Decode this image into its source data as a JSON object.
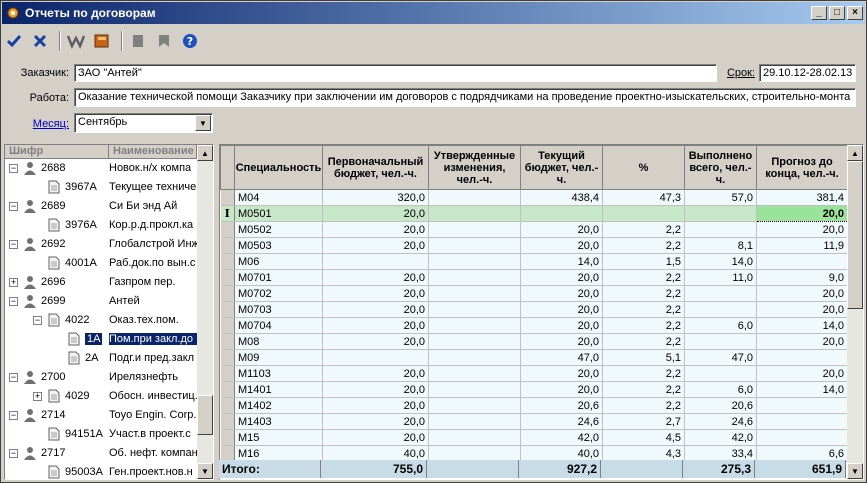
{
  "window": {
    "title": "Отчеты по договорам"
  },
  "form": {
    "customer_label": "Заказчик:",
    "customer_value": "ЗАО \"Антей\"",
    "term_label": "Срок:",
    "term_value": "29.10.12-28.02.13",
    "work_label": "Работа:",
    "work_value": "Оказание технической помощи Заказчику при заключении им договоров с подрядчиками на проведение проектно-изыскательских, строительно-монта",
    "month_label": "Месяц:",
    "month_value": "Сентябрь"
  },
  "tree": {
    "headers": [
      "Шифр",
      "Наименование"
    ],
    "rows": [
      {
        "level": 0,
        "code": "2688",
        "name": "Новок.н/х компа",
        "exp": "-"
      },
      {
        "level": 1,
        "code": "3967А",
        "name": "Текущее техниче",
        "exp": ""
      },
      {
        "level": 0,
        "code": "2689",
        "name": "Си Би энд Ай",
        "exp": "-"
      },
      {
        "level": 1,
        "code": "3976А",
        "name": "Кор.р.д.прокл.ка",
        "exp": ""
      },
      {
        "level": 0,
        "code": "2692",
        "name": "Глобалстрой Инж",
        "exp": "-"
      },
      {
        "level": 1,
        "code": "4001А",
        "name": "Раб.док.по вын.с",
        "exp": ""
      },
      {
        "level": 0,
        "code": "2696",
        "name": "Газпром пер.",
        "exp": "+"
      },
      {
        "level": 0,
        "code": "2699",
        "name": "Антей",
        "exp": "-"
      },
      {
        "level": 1,
        "code": "4022",
        "name": "Оказ.тех.пом.",
        "exp": "-"
      },
      {
        "level": 2,
        "code": "1А",
        "name": "Пом.при закл.до",
        "exp": "",
        "selected": true
      },
      {
        "level": 2,
        "code": "2А",
        "name": "Подг.и пред.закл",
        "exp": ""
      },
      {
        "level": 0,
        "code": "2700",
        "name": "Ирелязнефть",
        "exp": "-"
      },
      {
        "level": 1,
        "code": "4029",
        "name": "Обосн. инвестиц.",
        "exp": "+"
      },
      {
        "level": 0,
        "code": "2714",
        "name": "Toyo Engin. Corp.",
        "exp": "-"
      },
      {
        "level": 1,
        "code": "94151А",
        "name": "Участ.в проект.с",
        "exp": ""
      },
      {
        "level": 0,
        "code": "2717",
        "name": "Об. нефт. компан",
        "exp": "-"
      },
      {
        "level": 1,
        "code": "95003А",
        "name": "Ген.проект.нов.н",
        "exp": ""
      }
    ]
  },
  "grid": {
    "headers": [
      "Специальность",
      "Первоначальный бюджет, чел.-ч.",
      "Утвержденные изменения, чел.-ч.",
      "Текущий бюджет, чел.-ч.",
      "%",
      "Выполнено всего, чел.-ч.",
      "Прогноз до конца, чел.-ч."
    ],
    "rows": [
      [
        "М04",
        "320,0",
        "",
        "438,4",
        "47,3",
        "57,0",
        "381,4"
      ],
      [
        "М0501",
        "20,0",
        "",
        "",
        "",
        "",
        "20,0"
      ],
      [
        "М0502",
        "20,0",
        "",
        "20,0",
        "2,2",
        "",
        "20,0"
      ],
      [
        "М0503",
        "20,0",
        "",
        "20,0",
        "2,2",
        "8,1",
        "11,9"
      ],
      [
        "М06",
        "",
        "",
        "14,0",
        "1,5",
        "14,0",
        ""
      ],
      [
        "М0701",
        "20,0",
        "",
        "20,0",
        "2,2",
        "11,0",
        "9,0"
      ],
      [
        "М0702",
        "20,0",
        "",
        "20,0",
        "2,2",
        "",
        "20,0"
      ],
      [
        "М0703",
        "20,0",
        "",
        "20,0",
        "2,2",
        "",
        "20,0"
      ],
      [
        "М0704",
        "20,0",
        "",
        "20,0",
        "2,2",
        "6,0",
        "14,0"
      ],
      [
        "М08",
        "20,0",
        "",
        "20,0",
        "2,2",
        "",
        "20,0"
      ],
      [
        "М09",
        "",
        "",
        "47,0",
        "5,1",
        "47,0",
        ""
      ],
      [
        "М1103",
        "20,0",
        "",
        "20,0",
        "2,2",
        "",
        "20,0"
      ],
      [
        "М1401",
        "20,0",
        "",
        "20,0",
        "2,2",
        "6,0",
        "14,0"
      ],
      [
        "М1402",
        "20,0",
        "",
        "20,6",
        "2,2",
        "20,6",
        ""
      ],
      [
        "М1403",
        "20,0",
        "",
        "24,6",
        "2,7",
        "24,6",
        ""
      ],
      [
        "М15",
        "20,0",
        "",
        "42,0",
        "4,5",
        "42,0",
        ""
      ],
      [
        "М16",
        "40,0",
        "",
        "40,0",
        "4,3",
        "33,4",
        "6,6"
      ]
    ],
    "selected_row": 1,
    "totals": {
      "label": "Итого:",
      "initial": "755,0",
      "approved": "",
      "current": "927,2",
      "percent": "",
      "done": "275,3",
      "forecast": "651,9"
    }
  },
  "colors": {
    "title_start": "#0a246a",
    "title_end": "#a6caf0",
    "selected_row": "#c8e6c8",
    "grid_bg": "#f0fafc"
  }
}
